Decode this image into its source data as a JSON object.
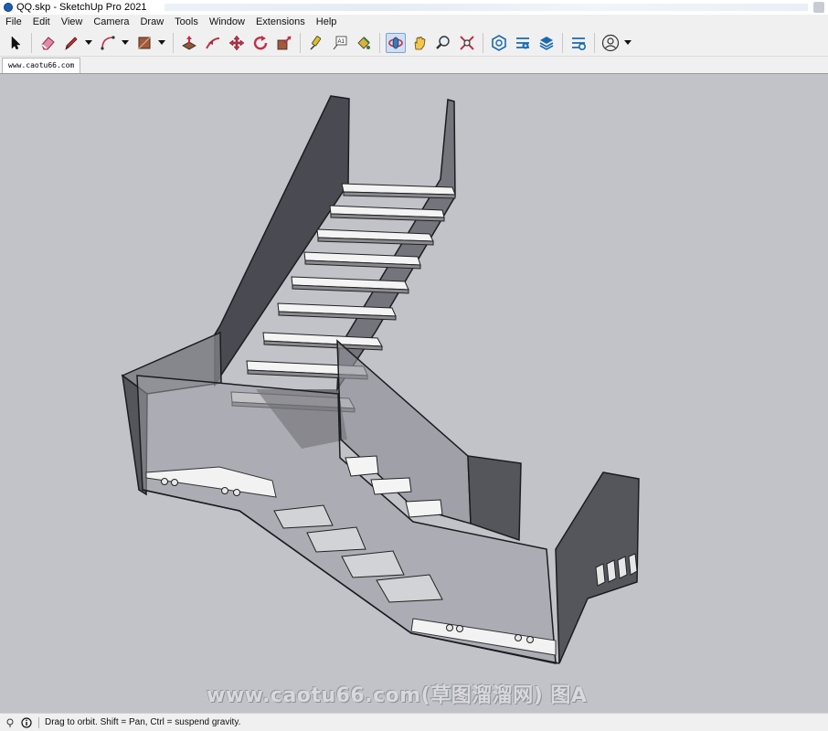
{
  "window": {
    "title": "QQ.skp - SketchUp Pro 2021"
  },
  "menu": {
    "items": [
      "File",
      "Edit",
      "View",
      "Camera",
      "Draw",
      "Tools",
      "Window",
      "Extensions",
      "Help"
    ]
  },
  "toolbar": {
    "tools": [
      {
        "name": "select-tool",
        "icon": "arrow-cursor-icon"
      },
      {
        "name": "eraser-tool",
        "icon": "eraser-icon"
      },
      {
        "name": "line-tool",
        "icon": "pencil-icon",
        "dropdown": true
      },
      {
        "name": "arc-tool",
        "icon": "arc-icon",
        "dropdown": true
      },
      {
        "name": "shape-tool",
        "icon": "rectangle-icon",
        "dropdown": true
      },
      {
        "name": "push-pull-tool",
        "icon": "push-pull-icon"
      },
      {
        "name": "follow-me-tool",
        "icon": "follow-me-icon"
      },
      {
        "name": "move-tool",
        "icon": "move-icon"
      },
      {
        "name": "rotate-tool",
        "icon": "rotate-icon"
      },
      {
        "name": "scale-tool",
        "icon": "scale-icon"
      },
      {
        "name": "tape-measure-tool",
        "icon": "tape-measure-icon"
      },
      {
        "name": "text-tool",
        "icon": "text-icon"
      },
      {
        "name": "paint-bucket-tool",
        "icon": "paint-bucket-icon"
      },
      {
        "name": "orbit-tool",
        "icon": "orbit-icon",
        "active": true
      },
      {
        "name": "pan-tool",
        "icon": "hand-icon"
      },
      {
        "name": "zoom-tool",
        "icon": "zoom-icon"
      },
      {
        "name": "zoom-extents-tool",
        "icon": "zoom-extents-icon"
      },
      {
        "name": "3d-warehouse",
        "icon": "warehouse-icon"
      },
      {
        "name": "extension-warehouse",
        "icon": "extension-warehouse-icon"
      },
      {
        "name": "layout-send",
        "icon": "layout-icon"
      },
      {
        "name": "extension-manager",
        "icon": "extension-manager-icon"
      },
      {
        "name": "account",
        "icon": "user-icon",
        "dropdown": true
      }
    ]
  },
  "scene_tab": {
    "label": "www.caotu66.com"
  },
  "viewport": {
    "background": "#c2c3c9",
    "watermark": "www.caotu66.com(草图溜溜网) 图A"
  },
  "status": {
    "message": "Drag to orbit. Shift = Pan, Ctrl = suspend gravity."
  }
}
